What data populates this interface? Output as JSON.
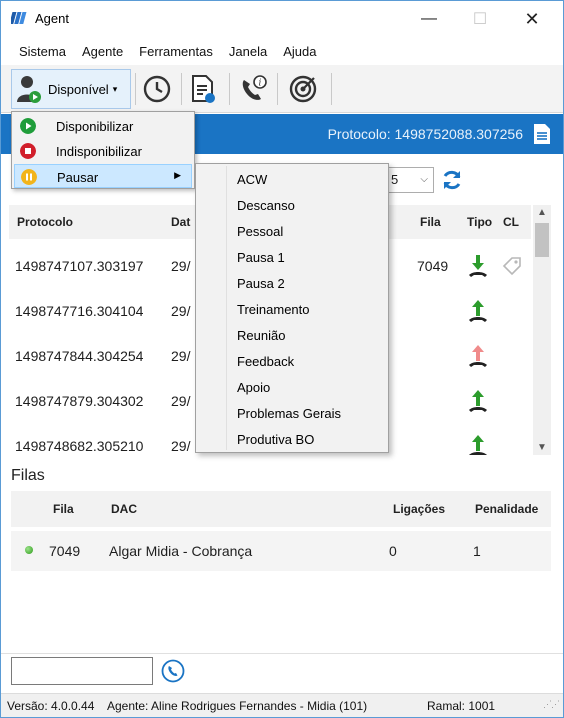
{
  "window": {
    "title": "Agent",
    "min": "—",
    "max": "☐",
    "close": "✕"
  },
  "menu": [
    "Sistema",
    "Agente",
    "Ferramentas",
    "Janela",
    "Ajuda"
  ],
  "toolbar": {
    "status_label": "Disponível",
    "caret": "▾"
  },
  "header": {
    "protocol": "Protocolo: 1498752088.307256"
  },
  "filter": {
    "value": "5",
    "arrow": "⌵"
  },
  "calls": {
    "columns": {
      "protocolo": "Protocolo",
      "data": "Dat",
      "fila": "Fila",
      "tipo": "Tipo",
      "cl": "CL"
    },
    "rows": [
      {
        "protocolo": "1498747107.303197",
        "data": "29/",
        "fila": "7049",
        "tipo": "in",
        "cl": true
      },
      {
        "protocolo": "1498747716.304104",
        "data": "29/",
        "fila": "",
        "tipo": "out",
        "cl": false
      },
      {
        "protocolo": "1498747844.304254",
        "data": "29/",
        "fila": "",
        "tipo": "out-missed",
        "cl": false
      },
      {
        "protocolo": "1498747879.304302",
        "data": "29/",
        "fila": "",
        "tipo": "out",
        "cl": false
      },
      {
        "protocolo": "1498748682.305210",
        "data": "29/",
        "fila": "",
        "tipo": "out",
        "cl": false
      }
    ]
  },
  "filas": {
    "title": "Filas",
    "columns": {
      "fila": "Fila",
      "dac": "DAC",
      "ligacoes": "Ligações",
      "penalidade": "Penalidade"
    },
    "rows": [
      {
        "fila": "7049",
        "dac": "Algar Midia - Cobrança",
        "ligacoes": "0",
        "penalidade": "1"
      }
    ]
  },
  "dial": {
    "value": ""
  },
  "statusbar": {
    "versao": "Versão: 4.0.0.44",
    "agente": "Agente: Aline Rodrigues Fernandes - Midia (101)",
    "ramal": "Ramal: 1001"
  },
  "status_menu": {
    "items": [
      {
        "label": "Disponibilizar",
        "icon": "play-icon",
        "color": "#1f9d3a"
      },
      {
        "label": "Indisponibilizar",
        "icon": "stop-icon",
        "color": "#d11f2b"
      },
      {
        "label": "Pausar",
        "icon": "pause-icon",
        "color": "#f2b41b",
        "submenu_arrow": "▶"
      }
    ]
  },
  "pause_menu": {
    "items": [
      "ACW",
      "Descanso",
      "Pessoal",
      "Pausa 1",
      "Pausa 2",
      "Treinamento",
      "Reunião",
      "Feedback",
      "Apoio",
      "Problemas Gerais",
      "Produtiva BO"
    ]
  },
  "colors": {
    "accent": "#1a74c4",
    "green": "#2c9c2c",
    "red_arrow": "#f08b8b"
  }
}
